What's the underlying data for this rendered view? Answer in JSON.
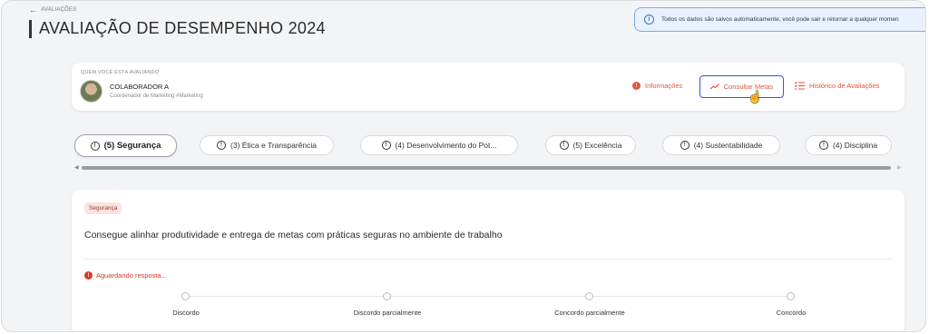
{
  "header": {
    "back_label": "AVALIAÇÕES",
    "title": "AVALIAÇÃO DE DESEMPENHO 2024"
  },
  "banner": {
    "text": "Todos os dados são salvos automaticamente, você pode sair e retornar a qualquer momen"
  },
  "evaluatee": {
    "label": "QUEM VOCÊ ESTÁ AVALIANDO",
    "name": "COLABORADOR A",
    "role": "Coordenador de Marketing #Marketing"
  },
  "actions": {
    "info": "Informações",
    "goals": "Consultar Metas",
    "history": "Histórico de Avaliações"
  },
  "tabs": [
    {
      "label": "(5) Segurança",
      "active": true
    },
    {
      "label": "(3) Ética e Transparência",
      "active": false
    },
    {
      "label": "(4) Desenvolvimento do Pot...",
      "active": false
    },
    {
      "label": "(5) Excelência",
      "active": false
    },
    {
      "label": "(4) Sustentabilidade",
      "active": false
    },
    {
      "label": "(4) Disciplina",
      "active": false
    }
  ],
  "question": {
    "tag": "Segurança",
    "text": "Consegue alinhar produtividade e entrega de metas com práticas seguras no ambiente de trabalho",
    "status": "Aguardando resposta...",
    "scale": [
      "Discordo",
      "Discordo parcialmente",
      "Concordo parcialmente",
      "Concordo"
    ]
  },
  "colors": {
    "accent": "#e0553c",
    "focus_border": "#3a57c9",
    "info_bg": "#e8f1fc",
    "error": "#d63b2b"
  }
}
